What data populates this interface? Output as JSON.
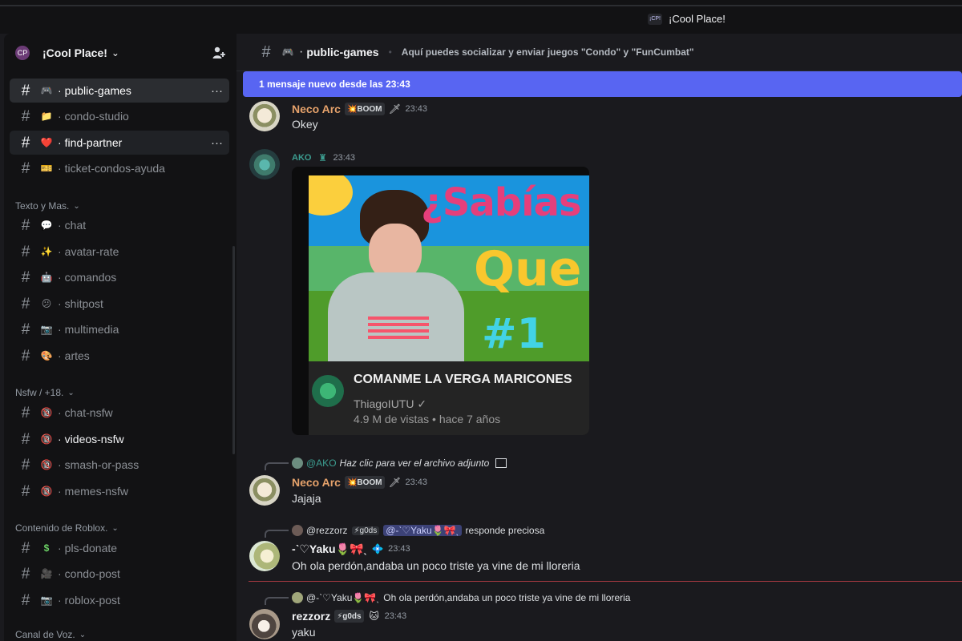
{
  "window": {
    "title": "¡Cool Place!",
    "icon_text": "¡CP!"
  },
  "server": {
    "name": "¡Cool Place!",
    "icon_text": "CP",
    "menu_chevron": "⌄",
    "invite_icon": "person-plus-icon"
  },
  "sidebar": {
    "categories": [
      {
        "label": "Texto y Mas.",
        "caret": "⌄"
      },
      {
        "label": "Nsfw / +18.",
        "caret": "⌄"
      },
      {
        "label": "Contenido de Roblox.",
        "caret": "⌄"
      },
      {
        "label": "Canal de Voz.",
        "caret": "⌄"
      }
    ],
    "channels": [
      {
        "name": "public-games",
        "emoji": "🎮",
        "state": "active"
      },
      {
        "name": "condo-studio",
        "emoji": "📁",
        "state": "normal"
      },
      {
        "name": "find-partner",
        "emoji": "❤️",
        "state": "hover"
      },
      {
        "name": "ticket-condos-ayuda",
        "emoji": "🎫",
        "state": "normal"
      },
      {
        "name": "chat",
        "emoji": "💬",
        "state": "normal"
      },
      {
        "name": "avatar-rate",
        "emoji": "✨",
        "state": "normal"
      },
      {
        "name": "comandos",
        "emoji": "🤖",
        "state": "normal"
      },
      {
        "name": "shitpost",
        "emoji": "😕",
        "state": "normal"
      },
      {
        "name": "multimedia",
        "emoji": "📷",
        "state": "normal"
      },
      {
        "name": "artes",
        "emoji": "🎨",
        "state": "normal"
      },
      {
        "name": "chat-nsfw",
        "emoji": "🔞",
        "state": "normal"
      },
      {
        "name": "videos-nsfw",
        "emoji": "🔞",
        "state": "bold"
      },
      {
        "name": "smash-or-pass",
        "emoji": "🔞",
        "state": "normal"
      },
      {
        "name": "memes-nsfw",
        "emoji": "🔞",
        "state": "normal"
      },
      {
        "name": "pls-donate",
        "emoji": "$",
        "state": "normal"
      },
      {
        "name": "condo-post",
        "emoji": "🎥",
        "state": "normal"
      },
      {
        "name": "roblox-post",
        "emoji": "📷",
        "state": "normal"
      }
    ],
    "more_label": "···"
  },
  "main": {
    "header": {
      "channel_name": "public-games",
      "channel_emoji": "🎮",
      "topic": "Aquí puedes socializar y enviar juegos \"Condo\" y \"FunCumbat\""
    },
    "new_message_banner": "1 mensaje nuevo desde las 23:43",
    "messages": [
      {
        "user": "Neco Arc",
        "tag": "💥BOOM",
        "badge": "🗡",
        "time": "23:43",
        "text": "Okey"
      },
      {
        "user": "AKO",
        "tag": "♜",
        "time": "23:43",
        "attachment": {
          "overlay_words": [
            "¿Sabías",
            "Que",
            "#1"
          ],
          "title": "COMANME LA VERGA MARICONES",
          "channel": "ThiagoIUTU",
          "stats": "4.9 M de vistas • hace 7 años"
        }
      },
      {
        "reply": {
          "mention": "@AKO",
          "text": "Haz clic para ver el archivo adjunto"
        },
        "user": "Neco Arc",
        "tag": "💥BOOM",
        "badge": "🗡",
        "time": "23:43",
        "text": "Jajaja"
      },
      {
        "reply": {
          "mention": "@rezzorz",
          "tag": "⚡g0ds",
          "target": "@-ˋ♡Yaku🌷🎀ˎ",
          "text": "responde preciosa"
        },
        "user": "-ˋ♡Yaku🌷🎀ˎ",
        "badge": "💠",
        "time": "23:43",
        "text": "Oh ola perdón,andaba un poco triste ya vine de mi lloreria"
      },
      {
        "reply": {
          "mention": "@-ˋ♡Yaku🌷🎀ˎ",
          "text": "Oh ola perdón,andaba un poco triste ya vine de mi lloreria"
        },
        "user": "rezzorz",
        "tag": "⚡g0ds",
        "badge": "🐱",
        "time": "23:43",
        "text": "yaku"
      }
    ]
  }
}
